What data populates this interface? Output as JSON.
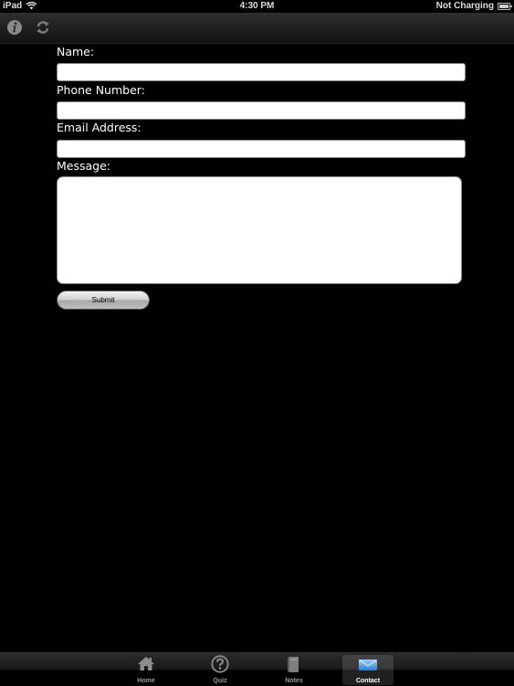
{
  "status_bar": {
    "carrier": "iPad",
    "time": "4:30 PM",
    "battery_status": "Not Charging"
  },
  "toolbar": {
    "icons": [
      "info-icon",
      "refresh-icon"
    ]
  },
  "form": {
    "name_label": "Name:",
    "name_value": "",
    "phone_label": "Phone Number:",
    "phone_value": "",
    "email_label": "Email Address:",
    "email_value": "",
    "message_label": "Message:",
    "message_value": "",
    "submit_label": "Submit"
  },
  "tab_bar": {
    "tabs": [
      {
        "label": "Home",
        "icon": "home-icon",
        "selected": false
      },
      {
        "label": "Quiz",
        "icon": "question-icon",
        "selected": false
      },
      {
        "label": "Notes",
        "icon": "notebook-icon",
        "selected": false
      },
      {
        "label": "Contact",
        "icon": "envelope-icon",
        "selected": true
      }
    ]
  },
  "colors": {
    "background": "#000000",
    "field_background": "#ffffff",
    "label_text": "#ffffff"
  }
}
